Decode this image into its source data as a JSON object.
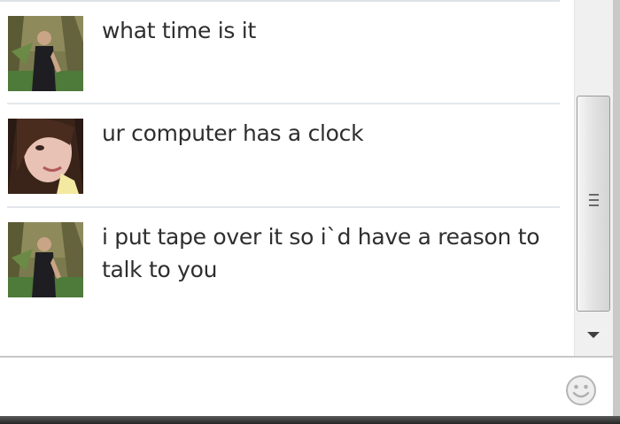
{
  "conversation": {
    "messages": [
      {
        "sender": "friend",
        "avatar_icon": "friend-photo-icon",
        "text": "what time is it"
      },
      {
        "sender": "self",
        "avatar_icon": "self-photo-icon",
        "text": "ur computer has a clock"
      },
      {
        "sender": "friend",
        "avatar_icon": "friend-photo-icon",
        "text": "i put tape over it so i`d have a reason to talk to you"
      }
    ]
  },
  "composer": {
    "value": "",
    "placeholder": "",
    "emoji_icon": "smiley-icon"
  },
  "colors": {
    "message_text": "#2e2e2e",
    "separator": "#e3e6ec",
    "scrollbar_track": "#f0f0f0",
    "bottom_bar": "#333333"
  }
}
